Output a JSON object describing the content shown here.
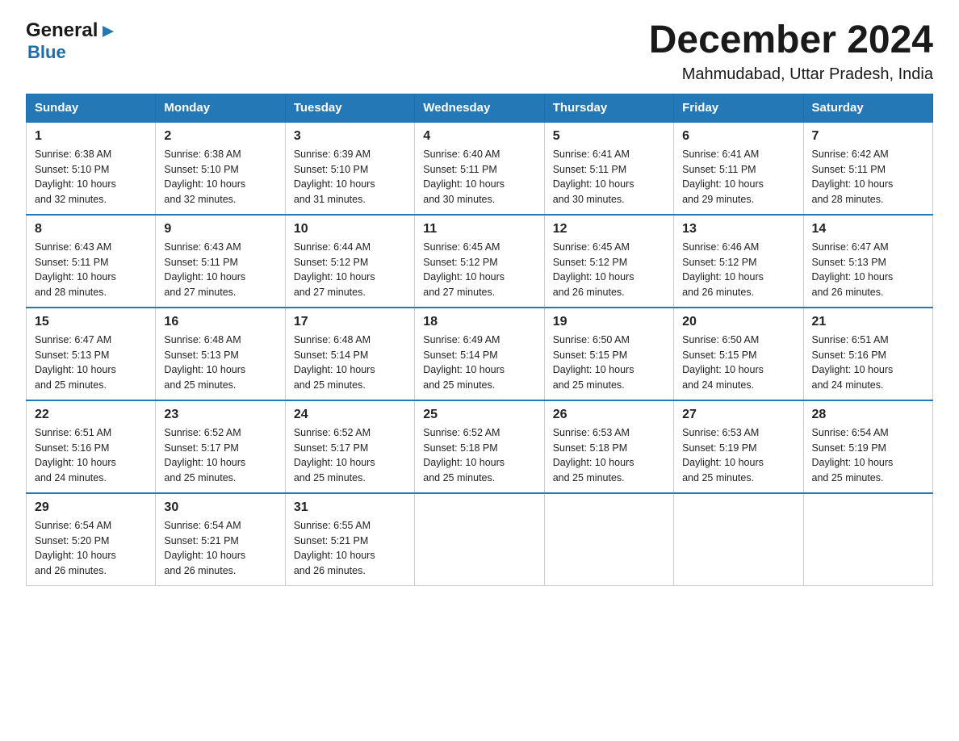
{
  "header": {
    "logo_general": "General",
    "logo_blue": "Blue",
    "main_title": "December 2024",
    "subtitle": "Mahmudabad, Uttar Pradesh, India"
  },
  "calendar": {
    "days_of_week": [
      "Sunday",
      "Monday",
      "Tuesday",
      "Wednesday",
      "Thursday",
      "Friday",
      "Saturday"
    ],
    "weeks": [
      [
        {
          "day": "1",
          "sunrise": "6:38 AM",
          "sunset": "5:10 PM",
          "daylight": "10 hours and 32 minutes."
        },
        {
          "day": "2",
          "sunrise": "6:38 AM",
          "sunset": "5:10 PM",
          "daylight": "10 hours and 32 minutes."
        },
        {
          "day": "3",
          "sunrise": "6:39 AM",
          "sunset": "5:10 PM",
          "daylight": "10 hours and 31 minutes."
        },
        {
          "day": "4",
          "sunrise": "6:40 AM",
          "sunset": "5:11 PM",
          "daylight": "10 hours and 30 minutes."
        },
        {
          "day": "5",
          "sunrise": "6:41 AM",
          "sunset": "5:11 PM",
          "daylight": "10 hours and 30 minutes."
        },
        {
          "day": "6",
          "sunrise": "6:41 AM",
          "sunset": "5:11 PM",
          "daylight": "10 hours and 29 minutes."
        },
        {
          "day": "7",
          "sunrise": "6:42 AM",
          "sunset": "5:11 PM",
          "daylight": "10 hours and 28 minutes."
        }
      ],
      [
        {
          "day": "8",
          "sunrise": "6:43 AM",
          "sunset": "5:11 PM",
          "daylight": "10 hours and 28 minutes."
        },
        {
          "day": "9",
          "sunrise": "6:43 AM",
          "sunset": "5:11 PM",
          "daylight": "10 hours and 27 minutes."
        },
        {
          "day": "10",
          "sunrise": "6:44 AM",
          "sunset": "5:12 PM",
          "daylight": "10 hours and 27 minutes."
        },
        {
          "day": "11",
          "sunrise": "6:45 AM",
          "sunset": "5:12 PM",
          "daylight": "10 hours and 27 minutes."
        },
        {
          "day": "12",
          "sunrise": "6:45 AM",
          "sunset": "5:12 PM",
          "daylight": "10 hours and 26 minutes."
        },
        {
          "day": "13",
          "sunrise": "6:46 AM",
          "sunset": "5:12 PM",
          "daylight": "10 hours and 26 minutes."
        },
        {
          "day": "14",
          "sunrise": "6:47 AM",
          "sunset": "5:13 PM",
          "daylight": "10 hours and 26 minutes."
        }
      ],
      [
        {
          "day": "15",
          "sunrise": "6:47 AM",
          "sunset": "5:13 PM",
          "daylight": "10 hours and 25 minutes."
        },
        {
          "day": "16",
          "sunrise": "6:48 AM",
          "sunset": "5:13 PM",
          "daylight": "10 hours and 25 minutes."
        },
        {
          "day": "17",
          "sunrise": "6:48 AM",
          "sunset": "5:14 PM",
          "daylight": "10 hours and 25 minutes."
        },
        {
          "day": "18",
          "sunrise": "6:49 AM",
          "sunset": "5:14 PM",
          "daylight": "10 hours and 25 minutes."
        },
        {
          "day": "19",
          "sunrise": "6:50 AM",
          "sunset": "5:15 PM",
          "daylight": "10 hours and 25 minutes."
        },
        {
          "day": "20",
          "sunrise": "6:50 AM",
          "sunset": "5:15 PM",
          "daylight": "10 hours and 24 minutes."
        },
        {
          "day": "21",
          "sunrise": "6:51 AM",
          "sunset": "5:16 PM",
          "daylight": "10 hours and 24 minutes."
        }
      ],
      [
        {
          "day": "22",
          "sunrise": "6:51 AM",
          "sunset": "5:16 PM",
          "daylight": "10 hours and 24 minutes."
        },
        {
          "day": "23",
          "sunrise": "6:52 AM",
          "sunset": "5:17 PM",
          "daylight": "10 hours and 25 minutes."
        },
        {
          "day": "24",
          "sunrise": "6:52 AM",
          "sunset": "5:17 PM",
          "daylight": "10 hours and 25 minutes."
        },
        {
          "day": "25",
          "sunrise": "6:52 AM",
          "sunset": "5:18 PM",
          "daylight": "10 hours and 25 minutes."
        },
        {
          "day": "26",
          "sunrise": "6:53 AM",
          "sunset": "5:18 PM",
          "daylight": "10 hours and 25 minutes."
        },
        {
          "day": "27",
          "sunrise": "6:53 AM",
          "sunset": "5:19 PM",
          "daylight": "10 hours and 25 minutes."
        },
        {
          "day": "28",
          "sunrise": "6:54 AM",
          "sunset": "5:19 PM",
          "daylight": "10 hours and 25 minutes."
        }
      ],
      [
        {
          "day": "29",
          "sunrise": "6:54 AM",
          "sunset": "5:20 PM",
          "daylight": "10 hours and 26 minutes."
        },
        {
          "day": "30",
          "sunrise": "6:54 AM",
          "sunset": "5:21 PM",
          "daylight": "10 hours and 26 minutes."
        },
        {
          "day": "31",
          "sunrise": "6:55 AM",
          "sunset": "5:21 PM",
          "daylight": "10 hours and 26 minutes."
        },
        null,
        null,
        null,
        null
      ]
    ],
    "labels": {
      "sunrise": "Sunrise:",
      "sunset": "Sunset:",
      "daylight": "Daylight:"
    }
  }
}
